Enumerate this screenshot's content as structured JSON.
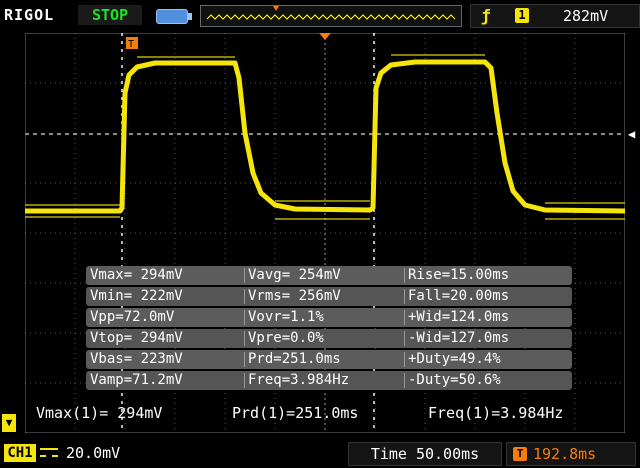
{
  "topbar": {
    "brand": "RIGOL",
    "run_state": "STOP",
    "trigger": {
      "edge_icon": "rising-edge-icon",
      "source": "1",
      "level": "282mV"
    }
  },
  "measurements": [
    [
      "Vmax= 294mV",
      "Vavg= 254mV",
      "Rise=15.00ms"
    ],
    [
      "Vmin= 222mV",
      "Vrms= 256mV",
      "Fall=20.00ms"
    ],
    [
      "Vpp=72.0mV",
      "Vovr=1.1%",
      "+Wid=124.0ms"
    ],
    [
      "Vtop= 294mV",
      "Vpre=0.0%",
      "-Wid=127.0ms"
    ],
    [
      "Vbas= 223mV",
      "Prd=251.0ms",
      "+Duty=49.4%"
    ],
    [
      "Vamp=71.2mV",
      "Freq=3.984Hz",
      "-Duty=50.6%"
    ]
  ],
  "footer_measures": {
    "vmax": "Vmax(1)= 294mV",
    "prd": "Prd(1)=251.0ms",
    "freq": "Freq(1)=3.984Hz"
  },
  "bottombar": {
    "channel": "CH1",
    "coupling_icon": "dc-coupling-icon",
    "scale": "20.0mV",
    "timebase": "Time 50.00ms",
    "trigger_offset": "192.8ms"
  },
  "colors": {
    "trace": "#f5e50a",
    "run_state": "#22e022",
    "trigger_marker": "#f57d0a",
    "grid": "#6e6e6e"
  }
}
